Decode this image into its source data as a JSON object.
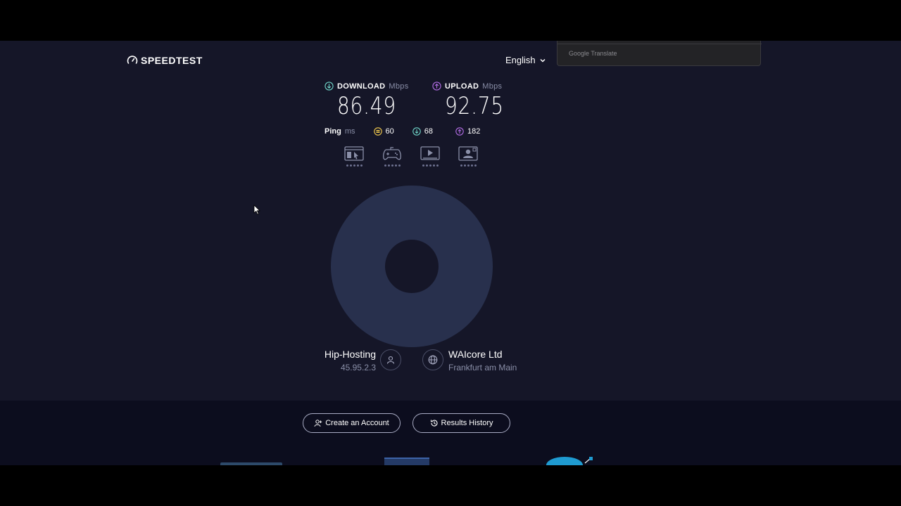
{
  "header": {
    "logo_text": "SPEEDTEST",
    "language": "English",
    "translate_label": "Google Translate"
  },
  "results": {
    "download": {
      "label": "DOWNLOAD",
      "unit": "Mbps",
      "value": "86.49"
    },
    "upload": {
      "label": "UPLOAD",
      "unit": "Mbps",
      "value": "92.75"
    },
    "ping": {
      "label": "Ping",
      "unit": "ms",
      "idle": "60",
      "download": "68",
      "upload": "182"
    },
    "task_icons": [
      "web-browsing-icon",
      "gaming-icon",
      "video-streaming-icon",
      "video-chat-icon"
    ]
  },
  "hosts": {
    "provider": {
      "name": "Hip-Hosting",
      "ip": "45.95.2.3"
    },
    "server": {
      "name": "WAIcore Ltd",
      "location": "Frankfurt am Main"
    }
  },
  "actions": {
    "create_account": "Create an Account",
    "results_history": "Results History"
  },
  "colors": {
    "background": "#151628",
    "footer": "#0c0d1e",
    "download_accent": "#6fd3c7",
    "upload_accent": "#b16ce3",
    "ping_accent": "#f2c94c",
    "gauge": "#28304d"
  }
}
